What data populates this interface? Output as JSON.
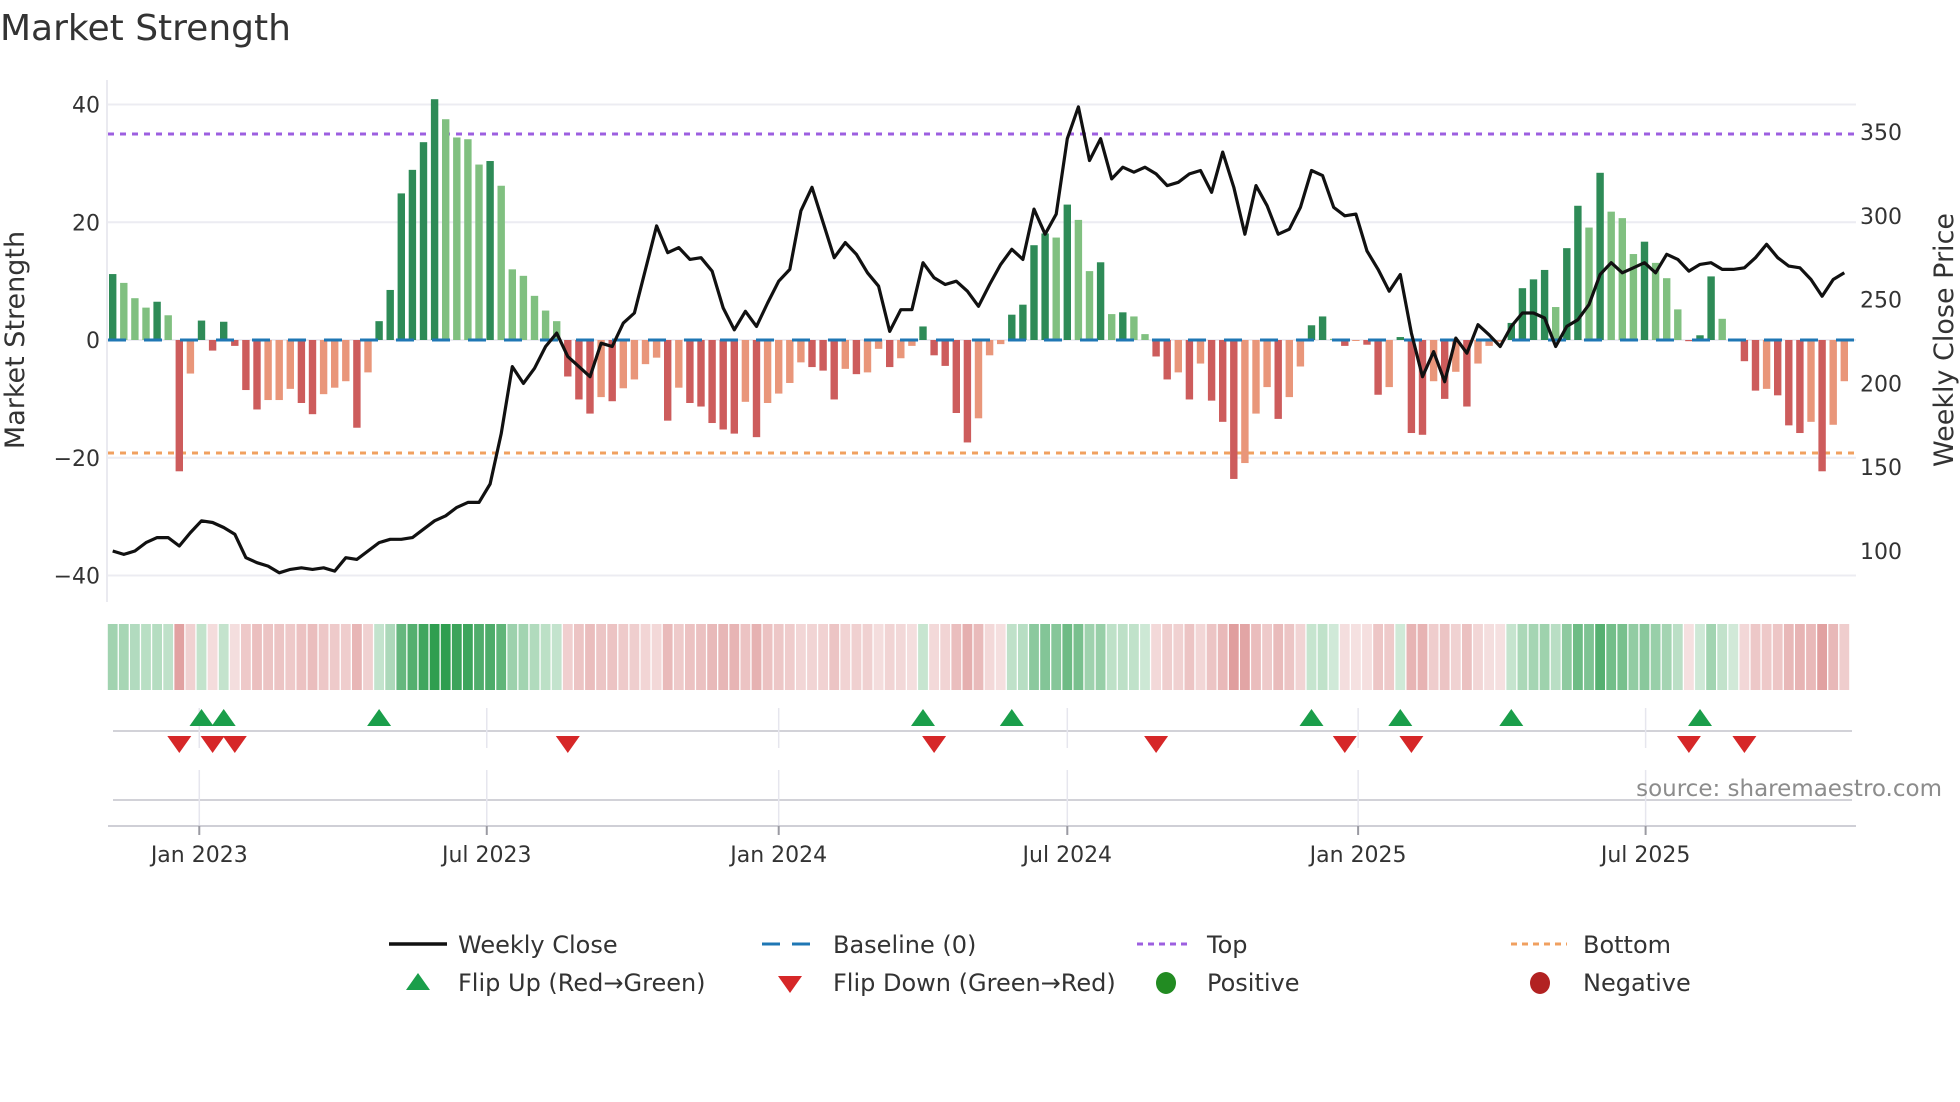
{
  "title": "Market Strength",
  "source": "source: sharemaestro.com",
  "legend": {
    "weekly_close": "Weekly Close",
    "baseline": "Baseline (0)",
    "top": "Top",
    "bottom": "Bottom",
    "flip_up": "Flip Up (Red→Green)",
    "flip_down": "Flip Down (Green→Red)",
    "positive": "Positive",
    "negative": "Negative"
  },
  "colors": {
    "strength_up_strong": "#2e8b57",
    "strength_up_weak": "#80c080",
    "strength_down_strong": "#cd5c5c",
    "strength_down_weak": "#e9967a",
    "baseline": "#1f77b4",
    "top": "#9d5fe0",
    "bottom": "#f0a060",
    "price": "#111111",
    "flip_up": "#1a9e4a",
    "flip_down": "#d62728",
    "positive": "#228b22",
    "negative": "#b22222"
  },
  "chart_data": {
    "type": "bar",
    "title": "Market Strength",
    "xlabel": "",
    "ylabel": "Market Strength",
    "y2label": "Weekly Close Price",
    "ylim": [
      -44,
      44
    ],
    "y2lim": [
      71,
      380
    ],
    "grid": true,
    "legend_placement": "bottom",
    "x_unit": "week index (1 = first weekly bar, early Nov 2022)",
    "x_ticks": [
      {
        "label": "Jan 2023",
        "x": 8.8
      },
      {
        "label": "Jul 2023",
        "x": 34.7
      },
      {
        "label": "Jan 2024",
        "x": 61.0
      },
      {
        "label": "Jul 2024",
        "x": 87.0
      },
      {
        "label": "Jan 2025",
        "x": 113.2
      },
      {
        "label": "Jul 2025",
        "x": 139.1
      }
    ],
    "y_ticks": [
      40,
      20,
      0,
      -20,
      -40
    ],
    "y_tick_labels": [
      "40",
      "20",
      "0",
      "−20",
      "−40"
    ],
    "y2_ticks": [
      350,
      300,
      250,
      200,
      150,
      100
    ],
    "y2_tick_labels": [
      "350",
      "300",
      "250",
      "200",
      "150",
      "100"
    ],
    "top_level": 35,
    "bottom_level": -19.2,
    "baseline": 0,
    "strength": [
      11.2,
      9.7,
      7.1,
      5.5,
      6.5,
      4.2,
      -22.3,
      -5.7,
      3.3,
      -1.8,
      3.1,
      -1.0,
      -8.5,
      -11.8,
      -10.2,
      -10.2,
      -8.3,
      -10.7,
      -12.6,
      -9.2,
      -8.1,
      -7.0,
      -14.9,
      -5.5,
      3.2,
      8.5,
      24.9,
      28.9,
      33.6,
      40.9,
      37.5,
      34.4,
      34.1,
      29.8,
      30.4,
      26.2,
      12.0,
      10.9,
      7.5,
      5.0,
      3.2,
      -6.2,
      -10.1,
      -12.5,
      -9.7,
      -10.4,
      -8.2,
      -6.7,
      -4.1,
      -3.0,
      -13.7,
      -8.1,
      -10.7,
      -11.3,
      -14.1,
      -15.2,
      -15.9,
      -10.5,
      -16.5,
      -10.7,
      -9.1,
      -7.3,
      -3.8,
      -4.6,
      -5.2,
      -10.1,
      -4.9,
      -5.8,
      -5.5,
      -1.5,
      -4.6,
      -3.1,
      -1.0,
      2.3,
      -2.6,
      -4.4,
      -12.4,
      -17.4,
      -13.3,
      -2.6,
      -0.7,
      4.3,
      6.0,
      16.1,
      18.1,
      17.4,
      23.0,
      20.4,
      11.7,
      13.2,
      4.4,
      4.7,
      4.0,
      1.0,
      -2.8,
      -6.7,
      -5.5,
      -10.1,
      -4.0,
      -10.3,
      -13.9,
      -23.6,
      -20.9,
      -12.5,
      -8.0,
      -13.4,
      -9.7,
      -4.5,
      2.5,
      4.0,
      0.2,
      -1.0,
      -0.1,
      -0.8,
      -9.3,
      -8.0,
      0.5,
      -15.8,
      -16.1,
      -7.0,
      -10.0,
      -5.4,
      -11.3,
      -4.0,
      -1.0,
      -0.3,
      2.9,
      8.8,
      10.3,
      11.9,
      5.6,
      15.6,
      22.8,
      19.1,
      28.4,
      21.8,
      20.7,
      14.6,
      16.7,
      13.1,
      10.5,
      5.2,
      -0.2,
      0.8,
      10.8,
      3.6,
      0.1,
      -3.6,
      -8.6,
      -8.3,
      -9.4,
      -14.5,
      -15.8,
      -13.9,
      -22.3,
      -14.4,
      -7.0
    ],
    "weekly_close": [
      100,
      98,
      100,
      105,
      108,
      108,
      103,
      111,
      118,
      117,
      114,
      110,
      96,
      93,
      91,
      87,
      89,
      90,
      89,
      90,
      88,
      96,
      95,
      100,
      105,
      107,
      107,
      108,
      113,
      118,
      121,
      126,
      129,
      129,
      140,
      170,
      210,
      200,
      209,
      222,
      230,
      216,
      210,
      204,
      224,
      222,
      236,
      242,
      268,
      294,
      278,
      281,
      274,
      275,
      267,
      245,
      232,
      243,
      234,
      248,
      261,
      268,
      303,
      317,
      296,
      275,
      284,
      277,
      266,
      258,
      231,
      244,
      244,
      272,
      263,
      259,
      261,
      255,
      246,
      259,
      271,
      280,
      274,
      304,
      289,
      301,
      346,
      365,
      333,
      346,
      322,
      329,
      326,
      329,
      325,
      318,
      320,
      325,
      327,
      314,
      338,
      317,
      289,
      318,
      306,
      289,
      292,
      305,
      327,
      324,
      305,
      300,
      301,
      279,
      268,
      255,
      265,
      230,
      204,
      219,
      201,
      227,
      218,
      235,
      229,
      222,
      234,
      242,
      242,
      239,
      222,
      234,
      238,
      247,
      265,
      272,
      266,
      269,
      272,
      266,
      277,
      274,
      267,
      271,
      272,
      268,
      268,
      269,
      275,
      283,
      275,
      270,
      269,
      262,
      252,
      262,
      266
    ],
    "flip_up_weeks": [
      9,
      11,
      25,
      74,
      82,
      109,
      117,
      127,
      144
    ],
    "flip_down_weeks": [
      7,
      10,
      12,
      42,
      75,
      95,
      112,
      118,
      143,
      148
    ]
  }
}
